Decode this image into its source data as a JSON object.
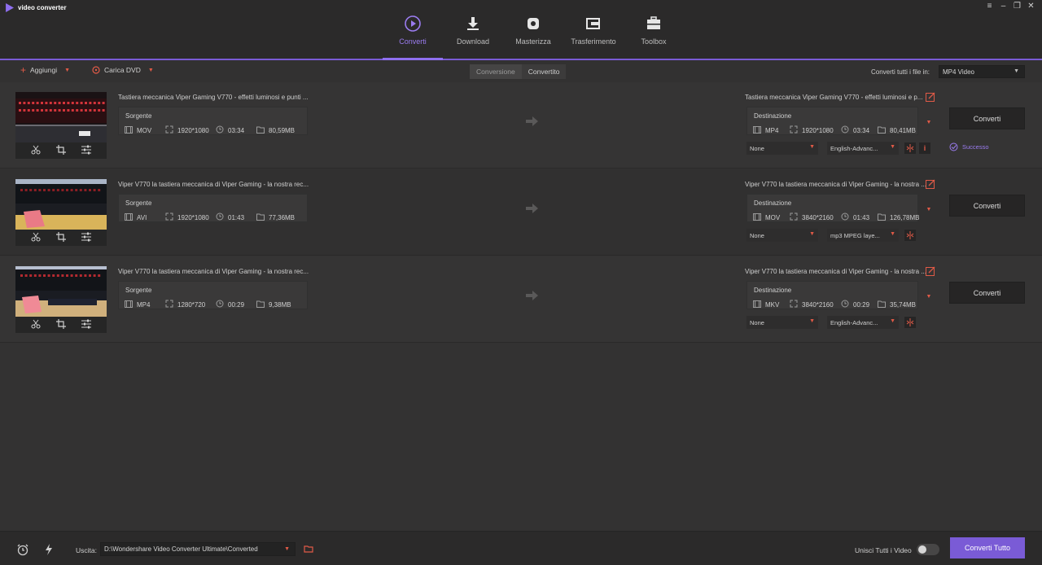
{
  "app": {
    "title": "video converter"
  },
  "nav": {
    "tabs": [
      {
        "label": "Converti",
        "icon": "convert-icon",
        "active": true
      },
      {
        "label": "Download",
        "icon": "download-icon"
      },
      {
        "label": "Masterizza",
        "icon": "burn-icon"
      },
      {
        "label": "Trasferimento",
        "icon": "transfer-icon"
      },
      {
        "label": "Toolbox",
        "icon": "toolbox-icon"
      }
    ]
  },
  "toolbar": {
    "add_label": "Aggiungi",
    "dvd_label": "Carica DVD",
    "seg_conversion": "Conversione",
    "seg_converted": "Convertito",
    "convert_all_label": "Converti tutti i file in:",
    "format_value": "MP4 Video"
  },
  "files": [
    {
      "src_title": "Tastiera meccanica Viper Gaming V770 - effetti luminosi e punti ...",
      "src_header": "Sorgente",
      "src_format": "MOV",
      "src_res": "1920*1080",
      "src_dur": "03:34",
      "src_size": "80,59MB",
      "dst_title": "Tastiera meccanica Viper Gaming V770 - effetti luminosi e p...",
      "dst_header": "Destinazione",
      "dst_format": "MP4",
      "dst_res": "1920*1080",
      "dst_dur": "03:34",
      "dst_size": "80,41MB",
      "subtitle": "None",
      "audio": "English-Advanc...",
      "convert_label": "Converti",
      "status": "Successo"
    },
    {
      "src_title": "Viper V770 la tastiera meccanica di Viper Gaming - la nostra rec...",
      "src_header": "Sorgente",
      "src_format": "AVI",
      "src_res": "1920*1080",
      "src_dur": "01:43",
      "src_size": "77,36MB",
      "dst_title": "Viper V770 la tastiera meccanica di Viper Gaming - la nostra ...",
      "dst_header": "Destinazione",
      "dst_format": "MOV",
      "dst_res": "3840*2160",
      "dst_dur": "01:43",
      "dst_size": "126,78MB",
      "subtitle": "None",
      "audio": "mp3 MPEG laye...",
      "convert_label": "Converti"
    },
    {
      "src_title": "Viper V770 la tastiera meccanica di Viper Gaming - la nostra rec...",
      "src_header": "Sorgente",
      "src_format": "MP4",
      "src_res": "1280*720",
      "src_dur": "00:29",
      "src_size": "9,38MB",
      "dst_title": "Viper V770 la tastiera meccanica di Viper Gaming - la nostra ...",
      "dst_header": "Destinazione",
      "dst_format": "MKV",
      "dst_res": "3840*2160",
      "dst_dur": "00:29",
      "dst_size": "35,74MB",
      "subtitle": "None",
      "audio": "English-Advanc...",
      "convert_label": "Converti"
    }
  ],
  "footer": {
    "output_label": "Uscita:",
    "output_path": "D:\\Wondershare Video Converter Ultimate\\Converted",
    "merge_label": "Unisci Tutti i Video",
    "merge_on": false,
    "convert_all_button": "Converti Tutto"
  },
  "colors": {
    "accent": "#7a5bd6",
    "accent_text": "#9b7cf0",
    "warn": "#e05a47"
  }
}
